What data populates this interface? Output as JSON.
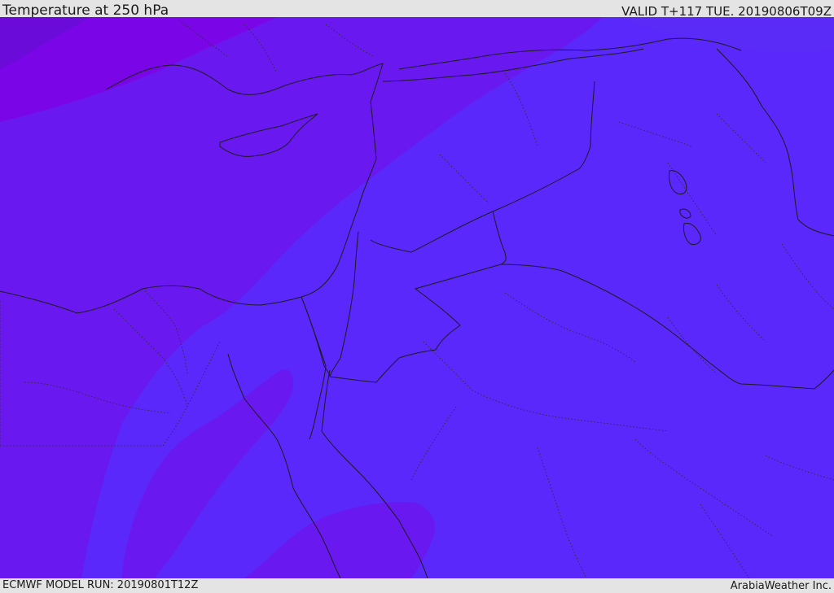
{
  "header": {
    "title": "Temperature at 250 hPa",
    "valid": "VALID T+117 TUE. 20190806T09Z"
  },
  "footer": {
    "model_run": "ECMWF MODEL RUN: 20190801T12Z",
    "credit": "ArabiaWeather Inc."
  },
  "map": {
    "colors": {
      "coldest": "#6a0bd9",
      "cold_corner": "#7a06e8",
      "mid": "#6a18f0",
      "warm": "#5a28fa",
      "warm_band": "#5a2cf4",
      "coast_line": "#1c1c1c"
    }
  }
}
